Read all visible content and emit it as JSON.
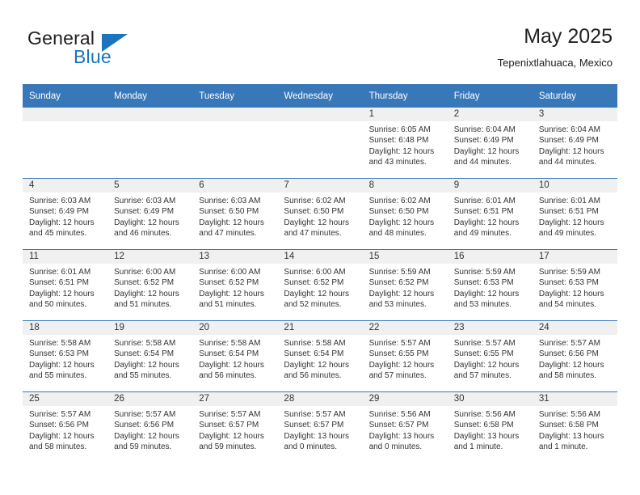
{
  "brand": {
    "name_part1": "General",
    "name_part2": "Blue",
    "accent_color": "#1b74bc"
  },
  "header": {
    "title": "May 2025",
    "subtitle": "Tepenixtlahuaca, Mexico"
  },
  "theme": {
    "header_bg": "#3878b9",
    "daynum_bg": "#f0f0f0",
    "text": "#333333"
  },
  "calendar": {
    "weekday_headers": [
      "Sunday",
      "Monday",
      "Tuesday",
      "Wednesday",
      "Thursday",
      "Friday",
      "Saturday"
    ],
    "weeks": [
      [
        {
          "day": "",
          "blank": true
        },
        {
          "day": "",
          "blank": true
        },
        {
          "day": "",
          "blank": true
        },
        {
          "day": "",
          "blank": true
        },
        {
          "day": "1",
          "sunrise": "Sunrise: 6:05 AM",
          "sunset": "Sunset: 6:48 PM",
          "daylight": "Daylight: 12 hours and 43 minutes."
        },
        {
          "day": "2",
          "sunrise": "Sunrise: 6:04 AM",
          "sunset": "Sunset: 6:49 PM",
          "daylight": "Daylight: 12 hours and 44 minutes."
        },
        {
          "day": "3",
          "sunrise": "Sunrise: 6:04 AM",
          "sunset": "Sunset: 6:49 PM",
          "daylight": "Daylight: 12 hours and 44 minutes."
        }
      ],
      [
        {
          "day": "4",
          "sunrise": "Sunrise: 6:03 AM",
          "sunset": "Sunset: 6:49 PM",
          "daylight": "Daylight: 12 hours and 45 minutes."
        },
        {
          "day": "5",
          "sunrise": "Sunrise: 6:03 AM",
          "sunset": "Sunset: 6:49 PM",
          "daylight": "Daylight: 12 hours and 46 minutes."
        },
        {
          "day": "6",
          "sunrise": "Sunrise: 6:03 AM",
          "sunset": "Sunset: 6:50 PM",
          "daylight": "Daylight: 12 hours and 47 minutes."
        },
        {
          "day": "7",
          "sunrise": "Sunrise: 6:02 AM",
          "sunset": "Sunset: 6:50 PM",
          "daylight": "Daylight: 12 hours and 47 minutes."
        },
        {
          "day": "8",
          "sunrise": "Sunrise: 6:02 AM",
          "sunset": "Sunset: 6:50 PM",
          "daylight": "Daylight: 12 hours and 48 minutes."
        },
        {
          "day": "9",
          "sunrise": "Sunrise: 6:01 AM",
          "sunset": "Sunset: 6:51 PM",
          "daylight": "Daylight: 12 hours and 49 minutes."
        },
        {
          "day": "10",
          "sunrise": "Sunrise: 6:01 AM",
          "sunset": "Sunset: 6:51 PM",
          "daylight": "Daylight: 12 hours and 49 minutes."
        }
      ],
      [
        {
          "day": "11",
          "sunrise": "Sunrise: 6:01 AM",
          "sunset": "Sunset: 6:51 PM",
          "daylight": "Daylight: 12 hours and 50 minutes."
        },
        {
          "day": "12",
          "sunrise": "Sunrise: 6:00 AM",
          "sunset": "Sunset: 6:52 PM",
          "daylight": "Daylight: 12 hours and 51 minutes."
        },
        {
          "day": "13",
          "sunrise": "Sunrise: 6:00 AM",
          "sunset": "Sunset: 6:52 PM",
          "daylight": "Daylight: 12 hours and 51 minutes."
        },
        {
          "day": "14",
          "sunrise": "Sunrise: 6:00 AM",
          "sunset": "Sunset: 6:52 PM",
          "daylight": "Daylight: 12 hours and 52 minutes."
        },
        {
          "day": "15",
          "sunrise": "Sunrise: 5:59 AM",
          "sunset": "Sunset: 6:52 PM",
          "daylight": "Daylight: 12 hours and 53 minutes."
        },
        {
          "day": "16",
          "sunrise": "Sunrise: 5:59 AM",
          "sunset": "Sunset: 6:53 PM",
          "daylight": "Daylight: 12 hours and 53 minutes."
        },
        {
          "day": "17",
          "sunrise": "Sunrise: 5:59 AM",
          "sunset": "Sunset: 6:53 PM",
          "daylight": "Daylight: 12 hours and 54 minutes."
        }
      ],
      [
        {
          "day": "18",
          "sunrise": "Sunrise: 5:58 AM",
          "sunset": "Sunset: 6:53 PM",
          "daylight": "Daylight: 12 hours and 55 minutes."
        },
        {
          "day": "19",
          "sunrise": "Sunrise: 5:58 AM",
          "sunset": "Sunset: 6:54 PM",
          "daylight": "Daylight: 12 hours and 55 minutes."
        },
        {
          "day": "20",
          "sunrise": "Sunrise: 5:58 AM",
          "sunset": "Sunset: 6:54 PM",
          "daylight": "Daylight: 12 hours and 56 minutes."
        },
        {
          "day": "21",
          "sunrise": "Sunrise: 5:58 AM",
          "sunset": "Sunset: 6:54 PM",
          "daylight": "Daylight: 12 hours and 56 minutes."
        },
        {
          "day": "22",
          "sunrise": "Sunrise: 5:57 AM",
          "sunset": "Sunset: 6:55 PM",
          "daylight": "Daylight: 12 hours and 57 minutes."
        },
        {
          "day": "23",
          "sunrise": "Sunrise: 5:57 AM",
          "sunset": "Sunset: 6:55 PM",
          "daylight": "Daylight: 12 hours and 57 minutes."
        },
        {
          "day": "24",
          "sunrise": "Sunrise: 5:57 AM",
          "sunset": "Sunset: 6:56 PM",
          "daylight": "Daylight: 12 hours and 58 minutes."
        }
      ],
      [
        {
          "day": "25",
          "sunrise": "Sunrise: 5:57 AM",
          "sunset": "Sunset: 6:56 PM",
          "daylight": "Daylight: 12 hours and 58 minutes."
        },
        {
          "day": "26",
          "sunrise": "Sunrise: 5:57 AM",
          "sunset": "Sunset: 6:56 PM",
          "daylight": "Daylight: 12 hours and 59 minutes."
        },
        {
          "day": "27",
          "sunrise": "Sunrise: 5:57 AM",
          "sunset": "Sunset: 6:57 PM",
          "daylight": "Daylight: 12 hours and 59 minutes."
        },
        {
          "day": "28",
          "sunrise": "Sunrise: 5:57 AM",
          "sunset": "Sunset: 6:57 PM",
          "daylight": "Daylight: 13 hours and 0 minutes."
        },
        {
          "day": "29",
          "sunrise": "Sunrise: 5:56 AM",
          "sunset": "Sunset: 6:57 PM",
          "daylight": "Daylight: 13 hours and 0 minutes."
        },
        {
          "day": "30",
          "sunrise": "Sunrise: 5:56 AM",
          "sunset": "Sunset: 6:58 PM",
          "daylight": "Daylight: 13 hours and 1 minute."
        },
        {
          "day": "31",
          "sunrise": "Sunrise: 5:56 AM",
          "sunset": "Sunset: 6:58 PM",
          "daylight": "Daylight: 13 hours and 1 minute."
        }
      ]
    ]
  }
}
